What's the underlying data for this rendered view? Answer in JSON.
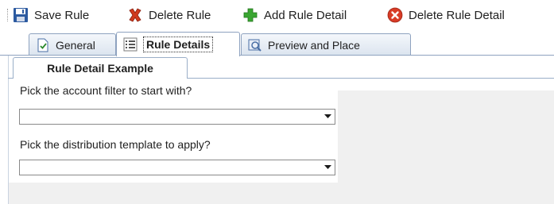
{
  "toolbar": {
    "save_label": "Save Rule",
    "delete_label": "Delete Rule",
    "add_detail_label": "Add Rule Detail",
    "delete_detail_label": "Delete Rule Detail"
  },
  "tabs": [
    {
      "label": "General",
      "icon": "document-check-icon"
    },
    {
      "label": "Rule Details",
      "icon": "list-icon",
      "selected": true
    },
    {
      "label": "Preview and Place",
      "icon": "preview-icon"
    }
  ],
  "inner_tab": {
    "label": "Rule Detail Example"
  },
  "form": {
    "account_filter_label": "Pick the account filter to start with?",
    "account_filter_value": "",
    "template_label": "Pick the distribution template to apply?",
    "template_value": ""
  },
  "colors": {
    "tab_border": "#8ea2bf",
    "panel_gray": "#f0f0f0",
    "save_icon": "#2c5aa0",
    "delete_icon": "#d03a1e",
    "add_icon": "#3aa632"
  }
}
